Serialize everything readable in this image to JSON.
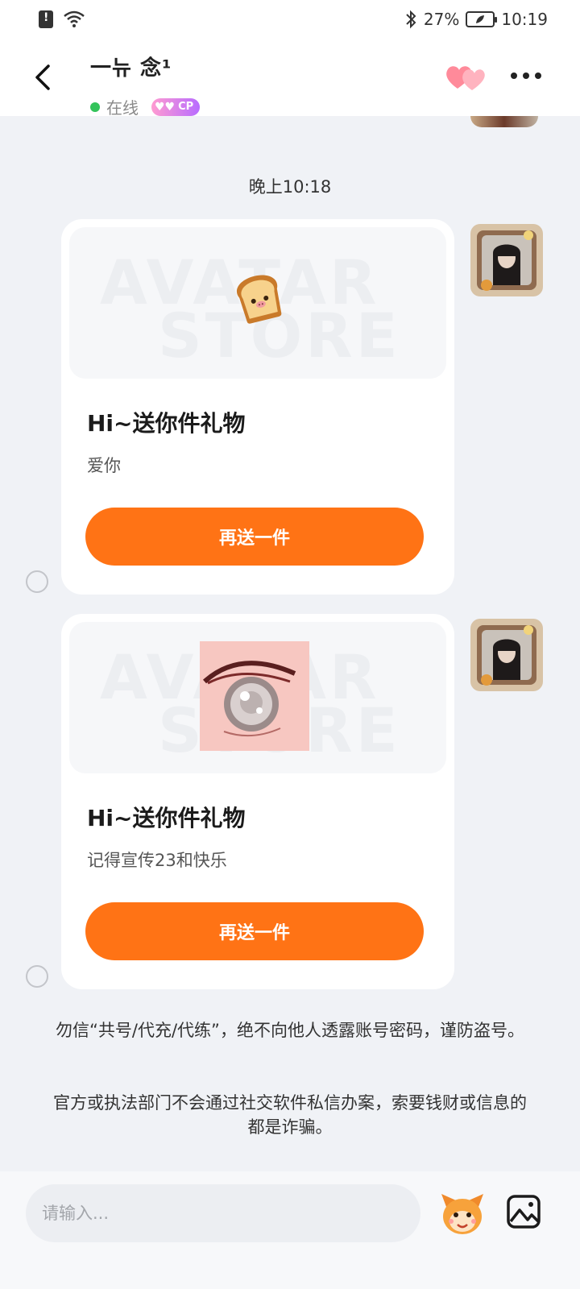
{
  "status_bar": {
    "battery_percent": "27%",
    "time": "10:19"
  },
  "header": {
    "contact_name": "一뉴 念¹",
    "online_status": "在线",
    "cp_badge": "CP"
  },
  "chat": {
    "timestamp": "晚上10:18",
    "gifts": [
      {
        "title": "Hi~送你件礼物",
        "message": "爱你",
        "button_label": "再送一件",
        "watermark_line1": "AVATAR",
        "watermark_line2": "STORE",
        "gift_icon": "toast-icon"
      },
      {
        "title": "Hi~送你件礼物",
        "message": "记得宣传23和快乐",
        "button_label": "再送一件",
        "watermark_line1": "AVATAR",
        "watermark_line2": "STORE",
        "gift_icon": "eye-image"
      }
    ],
    "notices": [
      "勿信“共号/代充/代练”，绝不向他人透露账号密码，谨防盗号。",
      "官方或执法部门不会通过社交软件私信办案，索要钱财或信息的都是诈骗。"
    ]
  },
  "input_bar": {
    "placeholder": "请输入..."
  },
  "colors": {
    "accent": "#ff7315",
    "background": "#f0f2f6",
    "online": "#33c35a"
  }
}
